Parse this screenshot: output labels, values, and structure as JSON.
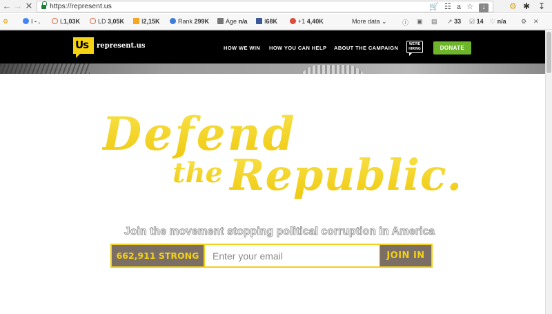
{
  "browser": {
    "url": "https://represent.us",
    "back_icon": "arrow-left-icon",
    "forward_icon": "arrow-right-icon",
    "stop_icon": "close-icon"
  },
  "seo_toolbar": {
    "items": [
      {
        "prefix": "I",
        "value": "- ."
      },
      {
        "prefix": "L",
        "value": "1,03K"
      },
      {
        "prefix": "LD",
        "value": "3,05K"
      },
      {
        "prefix": "I",
        "value": "2,15K"
      },
      {
        "prefix": "Rank",
        "value": "299K"
      },
      {
        "prefix": "Age",
        "value": "n/a"
      },
      {
        "prefix": "I",
        "value": "68K"
      },
      {
        "prefix": "+1",
        "value": "4,40K"
      }
    ],
    "more_data": "More data",
    "right_counts": [
      "33",
      "14",
      "n/a"
    ]
  },
  "site": {
    "logo_mark": "Us",
    "logo_text": "represent.us",
    "nav": [
      "HOW WE WIN",
      "HOW YOU CAN HELP",
      "ABOUT THE CAMPAIGN"
    ],
    "hiring_badge": "WE'RE HIRING",
    "donate_label": "DONATE"
  },
  "hero": {
    "title_line1": "Defend",
    "title_line2a": "the",
    "title_line2b": "Republic.",
    "tagline": "Join the movement stopping political corruption in America",
    "count_label": "662,911 STRONG",
    "email_placeholder": "Enter your email",
    "join_label": "JOIN IN"
  },
  "colors": {
    "accent_yellow": "#f3d117",
    "donate_green": "#6fb52c",
    "header_black": "#000000",
    "signup_brown": "#7b6e64"
  }
}
